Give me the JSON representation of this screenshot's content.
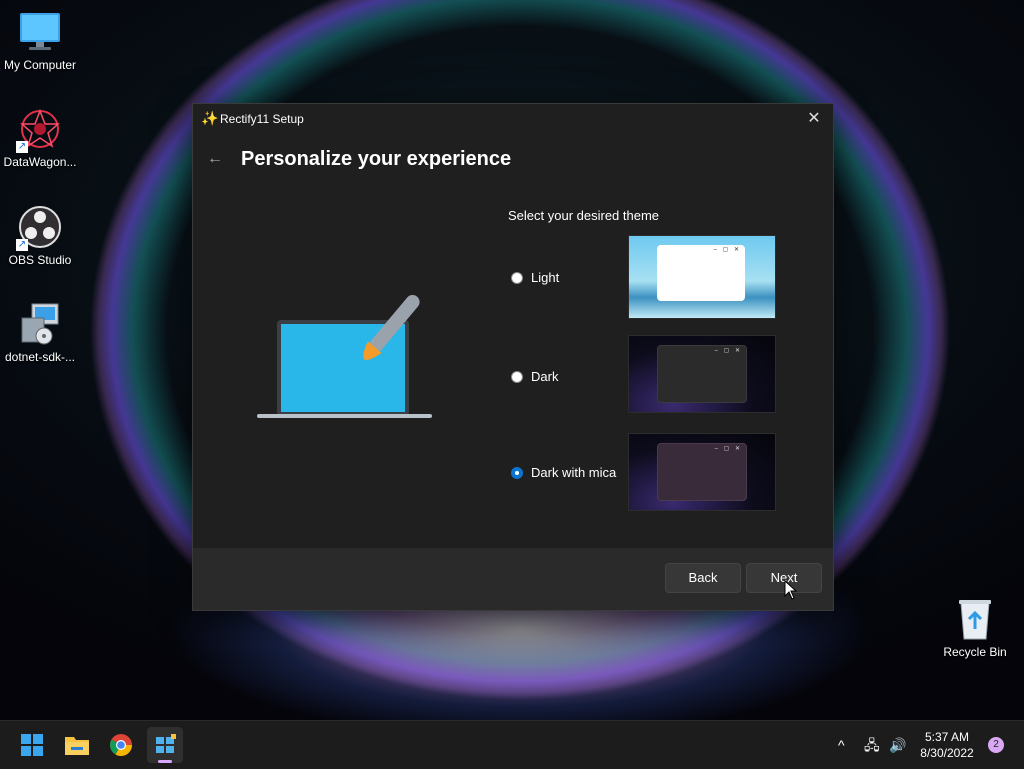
{
  "desktop": {
    "icons": [
      {
        "label": "My Computer",
        "icon": "computer-icon"
      },
      {
        "label": "DataWagon...",
        "icon": "datawagon-icon"
      },
      {
        "label": "OBS Studio",
        "icon": "obs-studio-icon"
      },
      {
        "label": "dotnet-sdk-...",
        "icon": "installer-icon"
      },
      {
        "label": "Recycle Bin",
        "icon": "recycle-bin-icon"
      }
    ]
  },
  "window": {
    "app_title": "Rectify11 Setup",
    "page_title": "Personalize your experience",
    "theme_heading": "Select your desired theme",
    "options": [
      {
        "label": "Light",
        "selected": false
      },
      {
        "label": "Dark",
        "selected": false
      },
      {
        "label": "Dark with mica",
        "selected": true
      }
    ],
    "back_label": "Back",
    "next_label": "Next"
  },
  "taskbar": {
    "apps": [
      "start-icon",
      "file-explorer-icon",
      "chrome-icon",
      "rectify11-icon"
    ],
    "time": "5:37 AM",
    "date": "8/30/2022",
    "notification_count": "2"
  },
  "colors": {
    "accent": "#0b74d1",
    "window_bg": "#1f1f1f",
    "footer_bg": "#2a2a2a"
  }
}
